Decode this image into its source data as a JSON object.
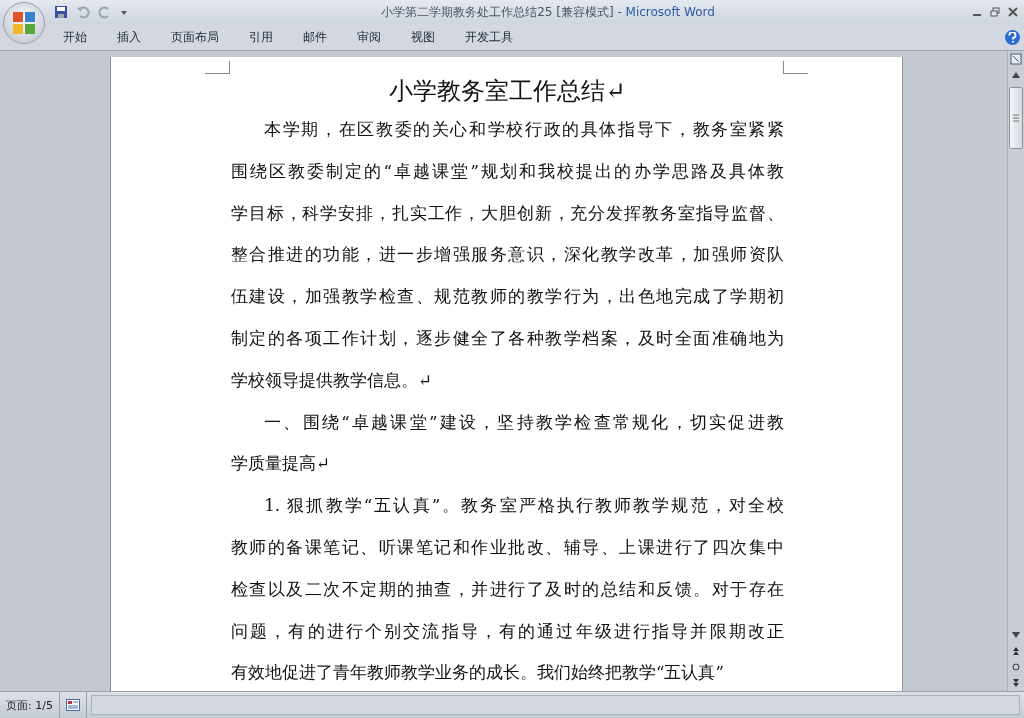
{
  "window": {
    "title": "小学第二学期教务处工作总结25 [兼容模式]",
    "app": " - Microsoft Word"
  },
  "ribbon_tabs": [
    {
      "label": "开始",
      "selected": false
    },
    {
      "label": "插入",
      "selected": false
    },
    {
      "label": "页面布局",
      "selected": false
    },
    {
      "label": "引用",
      "selected": false
    },
    {
      "label": "邮件",
      "selected": false
    },
    {
      "label": "审阅",
      "selected": false
    },
    {
      "label": "视图",
      "selected": false
    },
    {
      "label": "开发工具",
      "selected": false
    }
  ],
  "document": {
    "title": "小学教务室工作总结↵",
    "paragraphs": [
      {
        "lines": [
          "本学期，在区教委的关心和学校行政的具体指导下，教务室紧紧",
          "围绕区教委制定的“卓越课堂”规划和我校提出的办学思路及具体教",
          "学目标，科学安排，扎实工作，大胆创新，充分发挥教务室指导监督、",
          "整合推进的功能，进一步增强服务意识，深化教学改革，加强师资队",
          "伍建设，加强教学检查、规范教师的教学行为，出色地完成了学期初",
          "制定的各项工作计划，逐步健全了各种教学档案，及时全面准确地为",
          "学校领导提供教学信息。↵"
        ]
      },
      {
        "lines": [
          "一、围绕“卓越课堂”建设，坚持教学检查常规化，切实促进教",
          "学质量提高↵"
        ]
      },
      {
        "lines": [
          "1. 狠抓教学“五认真”。教务室严格执行教师教学规范，对全校",
          "教师的备课笔记、听课笔记和作业批改、辅导、上课进行了四次集中",
          "检查以及二次不定期的抽查，并进行了及时的总结和反馈。对于存在",
          "问题，有的进行个别交流指导，有的通过年级进行指导并限期改正",
          "有效地促进了青年教师教学业务的成长。我们始终把教学“五认真”"
        ]
      }
    ]
  },
  "status_bar": {
    "page": "页面: 1/5"
  }
}
